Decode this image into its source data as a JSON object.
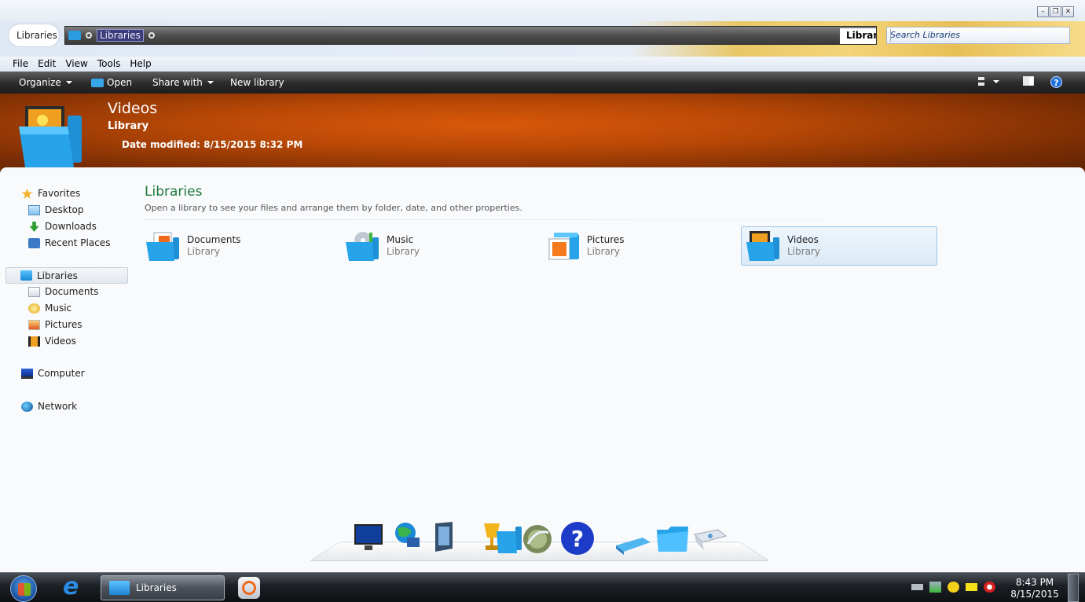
{
  "window": {
    "controls": {
      "minimize": "–",
      "restore": "❐",
      "close": "✕"
    }
  },
  "address_bar": {
    "nav_label": "Libraries",
    "crumb": "Libraries",
    "right_label": "Librar"
  },
  "search": {
    "placeholder": "Search Libraries"
  },
  "menubar": {
    "items": [
      "File",
      "Edit",
      "View",
      "Tools",
      "Help"
    ]
  },
  "toolbar": {
    "organize": "Organize",
    "open": "Open",
    "share_with": "Share with",
    "new_library": "New library",
    "help": "?"
  },
  "header": {
    "title": "Videos",
    "subtitle": "Library",
    "date_modified": "Date modified: 8/15/2015 8:32 PM"
  },
  "sidebar": {
    "favorites": {
      "label": "Favorites",
      "items": [
        "Desktop",
        "Downloads",
        "Recent Places"
      ]
    },
    "libraries": {
      "label": "Libraries",
      "items": [
        "Documents",
        "Music",
        "Pictures",
        "Videos"
      ]
    },
    "computer": "Computer",
    "network": "Network"
  },
  "main": {
    "title": "Libraries",
    "description": "Open a library to see your files and arrange them by folder, date, and other properties.",
    "tiles": [
      {
        "name": "Documents",
        "type": "Library",
        "icon": "documents-library-icon",
        "selected": false
      },
      {
        "name": "Music",
        "type": "Library",
        "icon": "music-library-icon",
        "selected": false
      },
      {
        "name": "Pictures",
        "type": "Library",
        "icon": "pictures-library-icon",
        "selected": false
      },
      {
        "name": "Videos",
        "type": "Library",
        "icon": "videos-library-icon",
        "selected": true
      }
    ]
  },
  "dock": {
    "icons": [
      "monitor-icon",
      "globe-network-icon",
      "tablet-icon",
      "trophy-icon",
      "library-folder-icon",
      "media-disc-icon",
      "help-icon",
      "drive-icon",
      "folder-icon",
      "recycle-bin-icon"
    ]
  },
  "taskbar": {
    "task_label": "Libraries",
    "time": "8:43 PM",
    "date": "8/15/2015"
  },
  "colors": {
    "header_orange": "#c24f07",
    "main_title_green": "#1e7a3a",
    "selection_blue": "#9ec6e6"
  }
}
